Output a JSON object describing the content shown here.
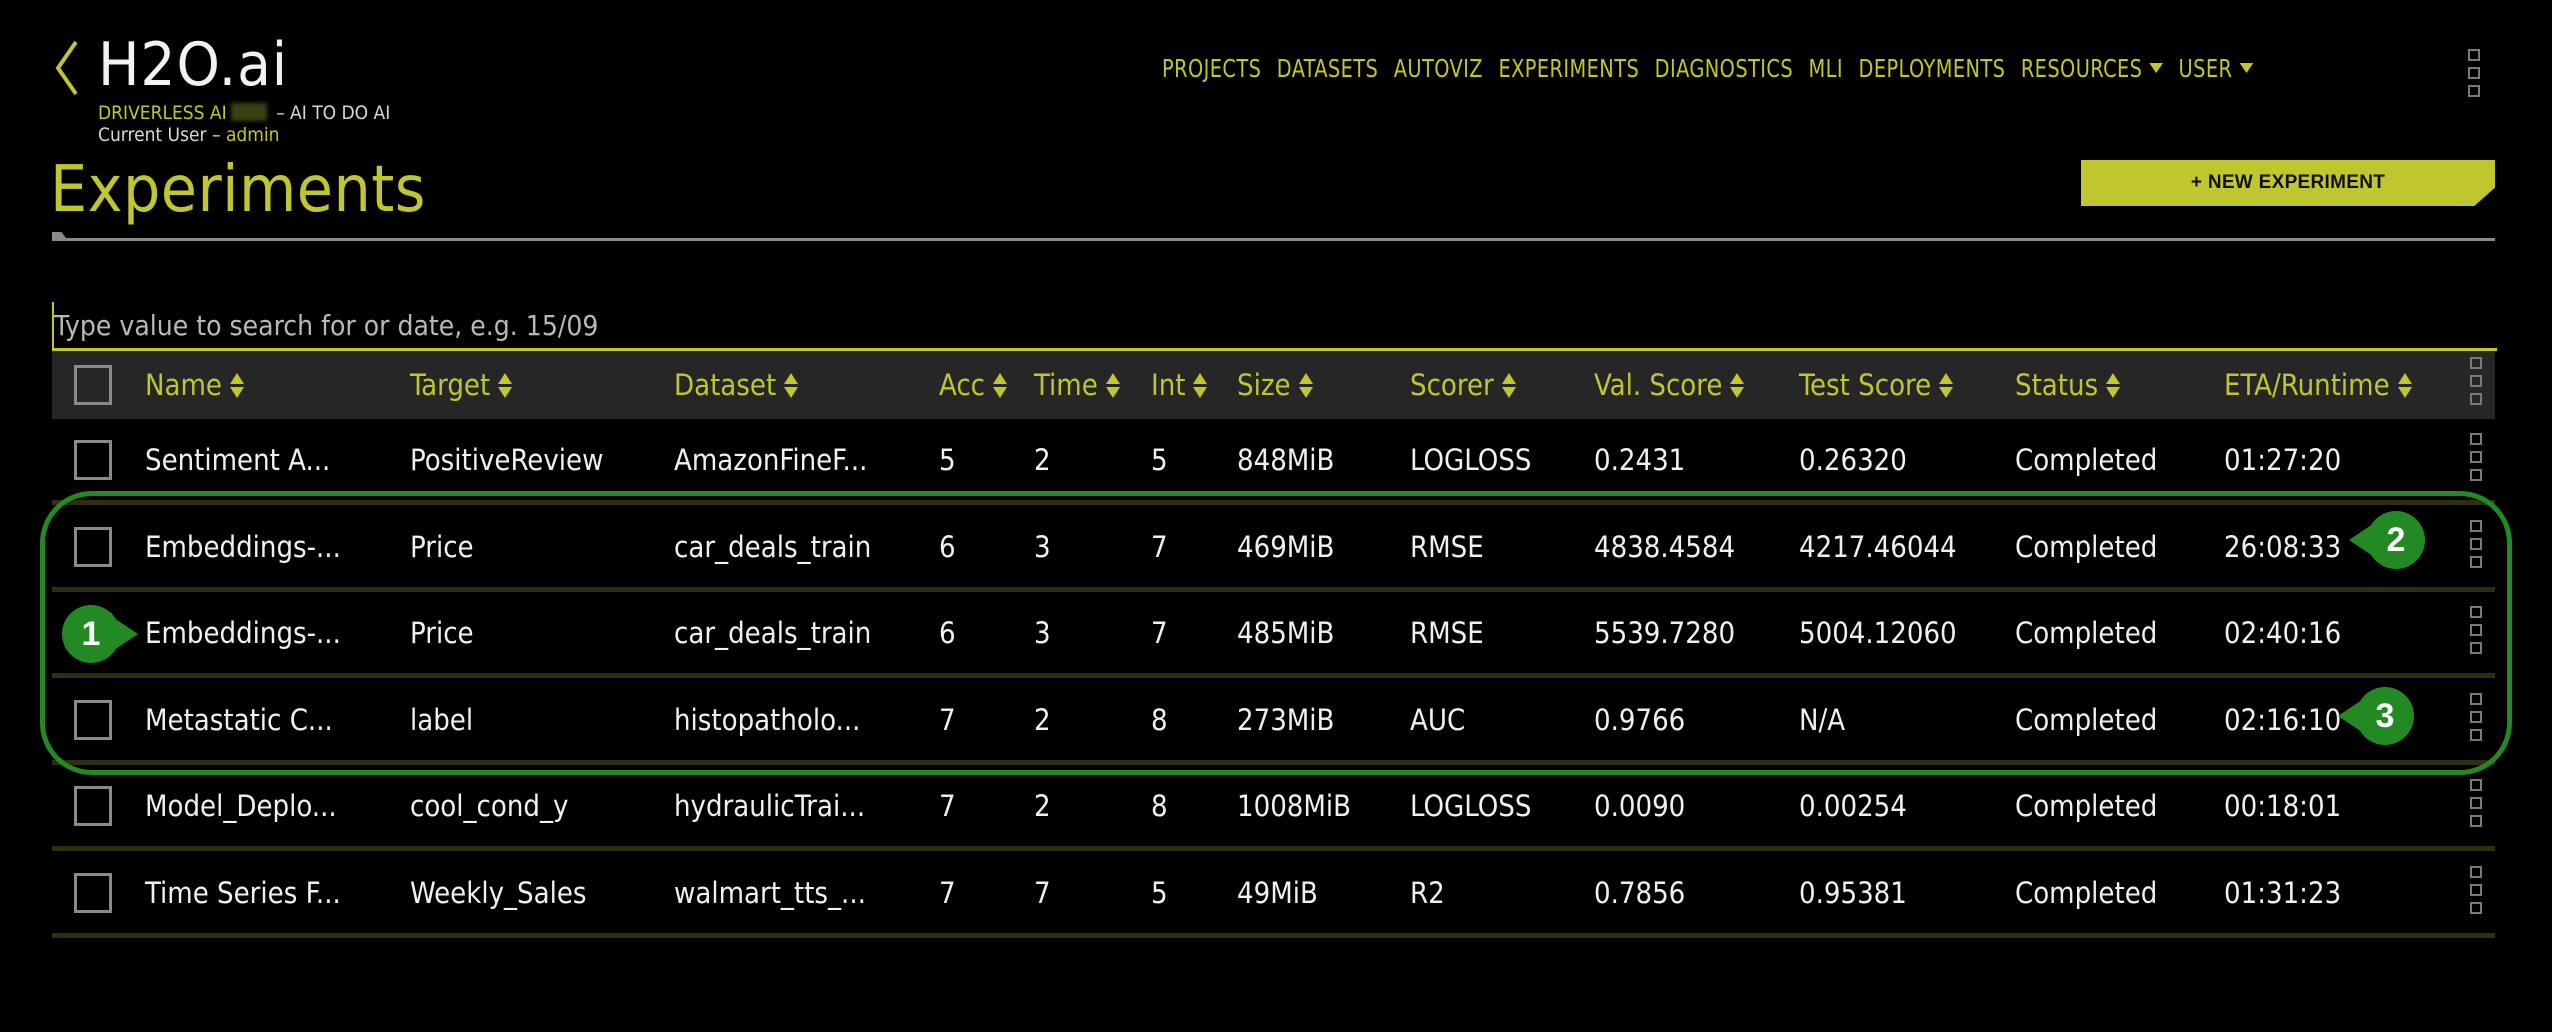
{
  "brand": {
    "title": "H2O.ai",
    "product": "DRIVERLESS AI",
    "tagline": "– AI TO DO AI",
    "user_prefix": "Current User –",
    "user_name": "admin"
  },
  "nav": {
    "items": [
      "PROJECTS",
      "DATASETS",
      "AUTOVIZ",
      "EXPERIMENTS",
      "DIAGNOSTICS",
      "MLI",
      "DEPLOYMENTS"
    ],
    "dropdowns": [
      "RESOURCES",
      "USER"
    ]
  },
  "page": {
    "title": "Experiments",
    "new_button": "+ NEW EXPERIMENT"
  },
  "search": {
    "placeholder": "Type value to search for or date, e.g. 15/09",
    "value": ""
  },
  "table": {
    "columns": [
      "Name",
      "Target",
      "Dataset",
      "Acc",
      "Time",
      "Int",
      "Size",
      "Scorer",
      "Val. Score",
      "Test Score",
      "Status",
      "ETA/Runtime"
    ],
    "rows": [
      [
        "Sentiment A...",
        "PositiveReview",
        "AmazonFineF...",
        "5",
        "2",
        "5",
        "848MiB",
        "LOGLOSS",
        "0.2431",
        "0.26320",
        "Completed",
        "01:27:20"
      ],
      [
        "Embeddings-...",
        "Price",
        "car_deals_train",
        "6",
        "3",
        "7",
        "469MiB",
        "RMSE",
        "4838.4584",
        "4217.46044",
        "Completed",
        "26:08:33"
      ],
      [
        "Embeddings-...",
        "Price",
        "car_deals_train",
        "6",
        "3",
        "7",
        "485MiB",
        "RMSE",
        "5539.7280",
        "5004.12060",
        "Completed",
        "02:40:16"
      ],
      [
        "Metastatic C...",
        "label",
        "histopatholo...",
        "7",
        "2",
        "8",
        "273MiB",
        "AUC",
        "0.9766",
        "N/A",
        "Completed",
        "02:16:10"
      ],
      [
        "Model_Deplo...",
        "cool_cond_y",
        "hydraulicTrai...",
        "7",
        "2",
        "8",
        "1008MiB",
        "LOGLOSS",
        "0.0090",
        "0.00254",
        "Completed",
        "00:18:01"
      ],
      [
        "Time Series F...",
        "Weekly_Sales",
        "walmart_tts_...",
        "7",
        "7",
        "5",
        "49MiB",
        "R2",
        "0.7856",
        "0.95381",
        "Completed",
        "01:31:23"
      ]
    ]
  },
  "annotations": {
    "markers": [
      "1",
      "2",
      "3"
    ],
    "color": "#238a23"
  },
  "colors": {
    "accent": "#c0c62d",
    "background": "#000000",
    "header_bg": "#262626"
  }
}
